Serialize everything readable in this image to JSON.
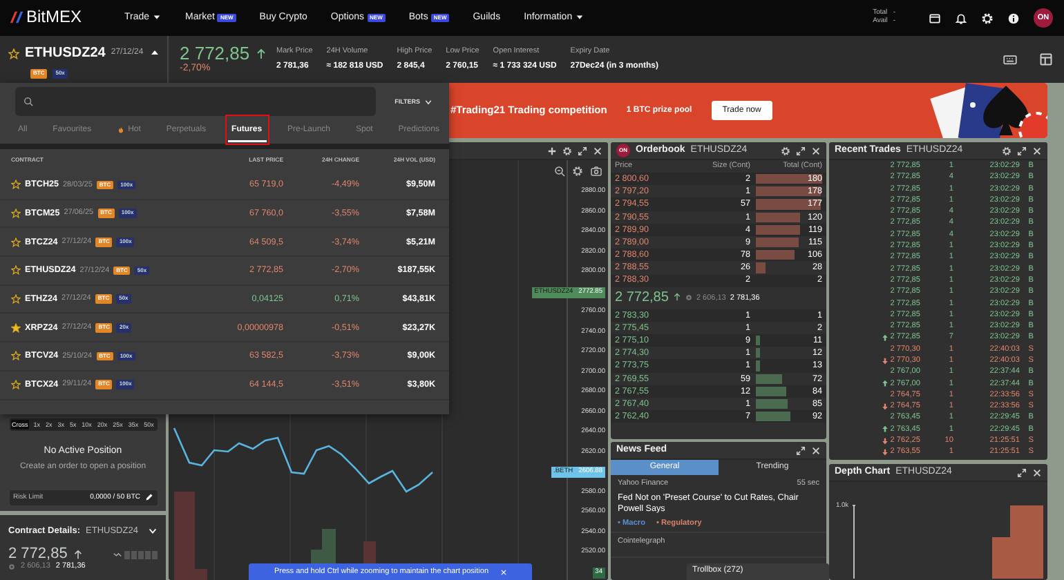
{
  "nav": {
    "logo": "Bit**MEX**",
    "items": [
      {
        "label": "Trade",
        "has_menu": true
      },
      {
        "label": "Market",
        "badge": "NEW"
      },
      {
        "label": "Buy Crypto"
      },
      {
        "label": "Options",
        "badge": "NEW"
      },
      {
        "label": "Bots",
        "badge": "NEW"
      },
      {
        "label": "Guilds"
      },
      {
        "label": "Information",
        "has_menu": true
      }
    ],
    "balances": [
      {
        "label": "Total",
        "value": "-"
      },
      {
        "label": "Avail",
        "value": "-"
      }
    ],
    "avatar": "ON"
  },
  "ticker": {
    "symbol": "ETHUSDZ24",
    "date": "27/12/24",
    "tags": [
      "BTC",
      "50x"
    ],
    "price": "2 772,85",
    "up": true,
    "change": "-2,70%",
    "stats": [
      {
        "label": "Mark Price",
        "value": "2 781,36"
      },
      {
        "label": "24H Volume",
        "value": "≈ 182 818 USD"
      },
      {
        "label": "High Price",
        "value": "2 845,4"
      },
      {
        "label": "Low Price",
        "value": "2 760,15"
      },
      {
        "label": "Open Interest",
        "value": "≈ 1 733 324 USD"
      },
      {
        "label": "Expiry Date",
        "value": "27Dec24 (in 3 months)"
      }
    ]
  },
  "market_dropdown": {
    "filters": "FILTERS",
    "tabs": [
      {
        "label": "All",
        "selected": false
      },
      {
        "label": "Favourites",
        "selected": false
      },
      {
        "label": "Hot",
        "selected": false,
        "kind": "hot"
      },
      {
        "label": "Perpetuals",
        "selected": false
      },
      {
        "label": "Futures",
        "selected": true,
        "highlighted": true
      },
      {
        "label": "Pre-Launch",
        "selected": false
      },
      {
        "label": "Spot",
        "selected": false
      },
      {
        "label": "Predictions",
        "selected": false
      }
    ],
    "columns": [
      "CONTRACT",
      "LAST PRICE",
      "24H CHANGE",
      "24H VOL (USD)"
    ],
    "rows": [
      {
        "symbol": "BTCH25",
        "date": "28/03/25",
        "tags": [
          "BTC",
          "100x"
        ],
        "price": "65 719,0",
        "change": "-4,49%",
        "volume": "$9,50M",
        "up": false,
        "favourite": false
      },
      {
        "symbol": "BTCM25",
        "date": "27/06/25",
        "tags": [
          "BTC",
          "100x"
        ],
        "price": "67 760,0",
        "change": "-3,55%",
        "volume": "$7,58M",
        "up": false,
        "favourite": false
      },
      {
        "symbol": "BTCZ24",
        "date": "27/12/24",
        "tags": [
          "BTC",
          "100x"
        ],
        "price": "64 509,5",
        "change": "-3,74%",
        "volume": "$5,21M",
        "up": false,
        "favourite": false
      },
      {
        "symbol": "ETHUSDZ24",
        "date": "27/12/24",
        "tags": [
          "BTC",
          "50x"
        ],
        "price": "2 772,85",
        "change": "-2,70%",
        "volume": "$187,55K",
        "up": false,
        "favourite": false
      },
      {
        "symbol": "ETHZ24",
        "date": "27/12/24",
        "tags": [
          "BTC",
          "50x"
        ],
        "price": "0,04125",
        "change": "0,71%",
        "volume": "$43,81K",
        "up": true,
        "favourite": false
      },
      {
        "symbol": "XRPZ24",
        "date": "27/12/24",
        "tags": [
          "BTC",
          "20x"
        ],
        "price": "0,00000978",
        "change": "-0,51%",
        "volume": "$23,27K",
        "up": false,
        "favourite": true
      },
      {
        "symbol": "BTCV24",
        "date": "25/10/24",
        "tags": [
          "BTC",
          "100x"
        ],
        "price": "63 582,5",
        "change": "-3,73%",
        "volume": "$9,00K",
        "up": false,
        "favourite": false
      },
      {
        "symbol": "BTCX24",
        "date": "29/11/24",
        "tags": [
          "BTC",
          "100x"
        ],
        "price": "64 144,5",
        "change": "-3,51%",
        "volume": "$3,80K",
        "up": false,
        "favourite": false
      }
    ]
  },
  "banner": {
    "title": "#Trading21 Trading competition",
    "subtitle": "1 BTC prize pool",
    "button": "Trade now"
  },
  "position_panel": {
    "leverage": [
      {
        "label": "Cross",
        "selected": true
      },
      {
        "label": "1x",
        "selected": false
      },
      {
        "label": "2x",
        "selected": false
      },
      {
        "label": "3x",
        "selected": false
      },
      {
        "label": "5x",
        "selected": false
      },
      {
        "label": "10x",
        "selected": false
      },
      {
        "label": "20x",
        "selected": false
      },
      {
        "label": "25x",
        "selected": false
      },
      {
        "label": "35x",
        "selected": false
      },
      {
        "label": "50x",
        "selected": false
      }
    ],
    "title": "No Active Position",
    "hint": "Create an order to open a position",
    "risk_label": "Risk Limit",
    "risk_value": "0,0000 / 50 BTC"
  },
  "contract_details": {
    "title": "Contract Details:",
    "symbol": "ETHUSDZ24",
    "price": "2 772,85",
    "index": "2 606,13",
    "mark": "2 781,36"
  },
  "chart": {
    "y_axis": [
      {
        "label": "2880.00"
      },
      {
        "label": "2860.00"
      },
      {
        "label": "2840.00"
      },
      {
        "label": "2820.00"
      },
      {
        "label": "2800.00"
      },
      {
        "kind": "tag",
        "name": "ETHUSDZ24",
        "label": "2772.85",
        "color": "#4e8a5a"
      },
      {
        "label": "2760.00"
      },
      {
        "label": "2740.00"
      },
      {
        "label": "2720.00"
      },
      {
        "label": "2700.00"
      },
      {
        "label": "2680.00"
      },
      {
        "label": "2660.00"
      },
      {
        "label": "2640.00"
      },
      {
        "label": "2620.00"
      },
      {
        "kind": "tag",
        "name": ".BETH",
        "label": "2606.88",
        "color": "#6fc3e8"
      },
      {
        "label": "2580.00"
      },
      {
        "label": "2560.00"
      },
      {
        "label": "2540.00"
      },
      {
        "label": "2520.00"
      },
      {
        "kind": "tag",
        "label": "34",
        "color": "#2f6a45"
      }
    ],
    "toast": "Press and hold Ctrl while zooming to maintain the chart position"
  },
  "orderbook": {
    "title": "Orderbook",
    "symbol": "ETHUSDZ24",
    "avatar": "ON",
    "columns": [
      "Price",
      "Size (Cont)",
      "Total (Cont)"
    ],
    "asks": [
      {
        "price": "2 800,60",
        "size": "2",
        "total": "180"
      },
      {
        "price": "2 797,20",
        "size": "1",
        "total": "178"
      },
      {
        "price": "2 794,55",
        "size": "57",
        "total": "177"
      },
      {
        "price": "2 790,55",
        "size": "1",
        "total": "120"
      },
      {
        "price": "2 789,90",
        "size": "4",
        "total": "119"
      },
      {
        "price": "2 789,00",
        "size": "9",
        "total": "115"
      },
      {
        "price": "2 788,60",
        "size": "78",
        "total": "106"
      },
      {
        "price": "2 788,55",
        "size": "26",
        "total": "28"
      },
      {
        "price": "2 788,30",
        "size": "2",
        "total": "2"
      }
    ],
    "last": "2 772,85",
    "index": "2 606,13",
    "mark": "2 781,36",
    "bids": [
      {
        "price": "2 783,30",
        "size": "1",
        "total": "1"
      },
      {
        "price": "2 775,45",
        "size": "1",
        "total": "2"
      },
      {
        "price": "2 775,10",
        "size": "9",
        "total": "11"
      },
      {
        "price": "2 774,30",
        "size": "1",
        "total": "12"
      },
      {
        "price": "2 773,75",
        "size": "1",
        "total": "13"
      },
      {
        "price": "2 769,55",
        "size": "59",
        "total": "72"
      },
      {
        "price": "2 767,55",
        "size": "12",
        "total": "84"
      },
      {
        "price": "2 767,40",
        "size": "1",
        "total": "85"
      },
      {
        "price": "2 762,40",
        "size": "7",
        "total": "92"
      }
    ]
  },
  "recent_trades": {
    "title": "Recent Trades",
    "symbol": "ETHUSDZ24",
    "rows": [
      {
        "price": "2 772,85",
        "size": "1",
        "time": "23:02:29",
        "side": "B",
        "tick": false
      },
      {
        "price": "2 772,85",
        "size": "4",
        "time": "23:02:29",
        "side": "B",
        "tick": false
      },
      {
        "price": "2 772,85",
        "size": "1",
        "time": "23:02:29",
        "side": "B",
        "tick": false
      },
      {
        "price": "2 772,85",
        "size": "1",
        "time": "23:02:29",
        "side": "B",
        "tick": false
      },
      {
        "price": "2 772,85",
        "size": "4",
        "time": "23:02:29",
        "side": "B",
        "tick": false
      },
      {
        "price": "2 772,85",
        "size": "4",
        "time": "23:02:29",
        "side": "B",
        "tick": false
      },
      {
        "price": "2 772,85",
        "size": "4",
        "time": "23:02:29",
        "side": "B",
        "tick": false
      },
      {
        "price": "2 772,85",
        "size": "1",
        "time": "23:02:29",
        "side": "B",
        "tick": false
      },
      {
        "price": "2 772,85",
        "size": "1",
        "time": "23:02:29",
        "side": "B",
        "tick": false
      },
      {
        "price": "2 772,85",
        "size": "1",
        "time": "23:02:29",
        "side": "B",
        "tick": false
      },
      {
        "price": "2 772,85",
        "size": "1",
        "time": "23:02:29",
        "side": "B",
        "tick": false
      },
      {
        "price": "2 772,85",
        "size": "1",
        "time": "23:02:29",
        "side": "B",
        "tick": false
      },
      {
        "price": "2 772,85",
        "size": "1",
        "time": "23:02:29",
        "side": "B",
        "tick": false
      },
      {
        "price": "2 772,85",
        "size": "1",
        "time": "23:02:29",
        "side": "B",
        "tick": false
      },
      {
        "price": "2 772,85",
        "size": "1",
        "time": "23:02:29",
        "side": "B",
        "tick": false
      },
      {
        "price": "2 772,85",
        "size": "7",
        "time": "23:02:29",
        "side": "B",
        "tick": true
      },
      {
        "price": "2 770,30",
        "size": "1",
        "time": "22:40:03",
        "side": "S",
        "tick": false
      },
      {
        "price": "2 770,30",
        "size": "1",
        "time": "22:40:03",
        "side": "S",
        "tick": true
      },
      {
        "price": "2 767,00",
        "size": "1",
        "time": "22:37:44",
        "side": "B",
        "tick": false
      },
      {
        "price": "2 767,00",
        "size": "1",
        "time": "22:37:44",
        "side": "B",
        "tick": true
      },
      {
        "price": "2 764,75",
        "size": "1",
        "time": "22:33:56",
        "side": "S",
        "tick": false
      },
      {
        "price": "2 764,75",
        "size": "1",
        "time": "22:33:56",
        "side": "S",
        "tick": true
      },
      {
        "price": "2 763,45",
        "size": "1",
        "time": "22:29:45",
        "side": "B",
        "tick": false
      },
      {
        "price": "2 763,45",
        "size": "1",
        "time": "22:29:45",
        "side": "B",
        "tick": true
      },
      {
        "price": "2 762,25",
        "size": "10",
        "time": "21:25:51",
        "side": "S",
        "tick": true
      },
      {
        "price": "2 763,55",
        "size": "1",
        "time": "21:25:51",
        "side": "S",
        "tick": true
      }
    ]
  },
  "news_feed": {
    "title": "News Feed",
    "tabs": [
      {
        "label": "General",
        "selected": true
      },
      {
        "label": "Trending",
        "selected": false
      }
    ],
    "items": [
      {
        "source": "Yahoo Finance",
        "age": "55 sec",
        "headline": "Fed Not on 'Preset Course' to Cut Rates, Chair Powell Says",
        "tags": [
          {
            "label": "• Macro",
            "color": "#5b8fd0"
          },
          {
            "label": "• Regulatory",
            "color": "#d9836b"
          }
        ]
      },
      {
        "source": "Cointelegraph"
      }
    ]
  },
  "trollbox": "Trollbox (272)",
  "depth_chart": {
    "title": "Depth Chart",
    "symbol": "ETHUSDZ24",
    "y_label": "1.0k"
  }
}
